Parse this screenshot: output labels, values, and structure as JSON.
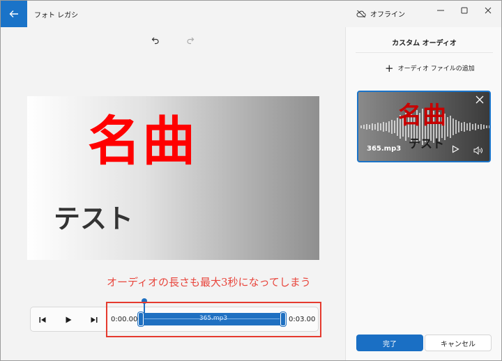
{
  "titlebar": {
    "app_title": "フォト レガシ",
    "offline_label": "オフライン",
    "back_icon": "arrow-left-icon",
    "minimize_icon": "minimize-icon",
    "maximize_icon": "maximize-icon",
    "close_icon": "close-icon"
  },
  "toolbar": {
    "undo_icon": "undo-icon",
    "redo_icon": "redo-icon"
  },
  "preview": {
    "title": "名曲",
    "subtitle": "テスト"
  },
  "annotation": {
    "text": "オーディオの長さも最大3秒になってしまう"
  },
  "playback": {
    "prev_icon": "skip-back-icon",
    "play_icon": "play-icon",
    "next_icon": "skip-forward-icon",
    "start_time": "0:00.00",
    "end_time": "0:03.00",
    "track_label": "365.mp3"
  },
  "panel": {
    "title": "カスタム オーディオ",
    "add_label": "オーディオ ファイルの追加",
    "card": {
      "title": "名曲",
      "subtitle": "テスト",
      "file_name": "365.mp3"
    },
    "done_label": "完了",
    "cancel_label": "キャンセル"
  },
  "colors": {
    "accent": "#1a73c8",
    "annotation": "#e8453c",
    "preview_title": "#ff0000"
  }
}
